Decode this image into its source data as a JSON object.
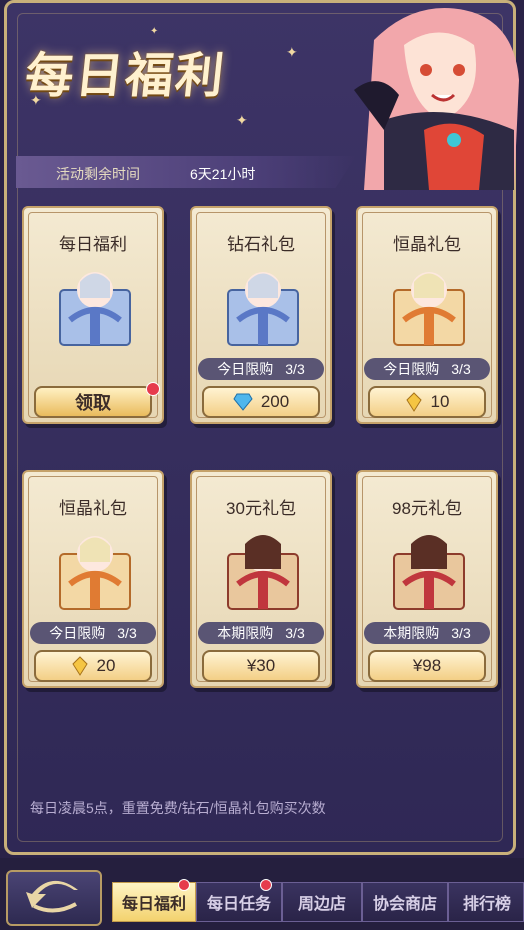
{
  "header": {
    "title": "每日福利",
    "time_label": "活动剩余时间",
    "time_value": "6天21小时"
  },
  "cards": [
    {
      "title": "每日福利",
      "button": "领取",
      "type": "claim",
      "gift_color": "#5a78c6"
    },
    {
      "title": "钻石礼包",
      "limit": "今日限购",
      "limit_count": "3/3",
      "price": "200",
      "currency_icon": "diamond-icon",
      "gift_color": "#5a78c6"
    },
    {
      "title": "恒晶礼包",
      "limit": "今日限购",
      "limit_count": "3/3",
      "price": "10",
      "currency_icon": "crystal-icon",
      "gift_color": "#e07b33"
    },
    {
      "title": "恒晶礼包",
      "limit": "今日限购",
      "limit_count": "3/3",
      "price": "20",
      "currency_icon": "crystal-icon",
      "gift_color": "#e07b33"
    },
    {
      "title": "30元礼包",
      "limit": "本期限购",
      "limit_count": "3/3",
      "price": "¥30",
      "gift_color": "#c0363d"
    },
    {
      "title": "98元礼包",
      "limit": "本期限购",
      "limit_count": "3/3",
      "price": "¥98",
      "gift_color": "#c0363d"
    }
  ],
  "footnote": "每日凌晨5点，重置免费/钻石/恒晶礼包购买次数",
  "tabs": [
    {
      "label": "每日福利",
      "active": true,
      "dot": true
    },
    {
      "label": "每日任务",
      "active": false,
      "dot": true
    },
    {
      "label": "周边店",
      "active": false,
      "dot": false
    },
    {
      "label": "协会商店",
      "active": false,
      "dot": false
    },
    {
      "label": "排行榜",
      "active": false,
      "dot": false
    }
  ]
}
